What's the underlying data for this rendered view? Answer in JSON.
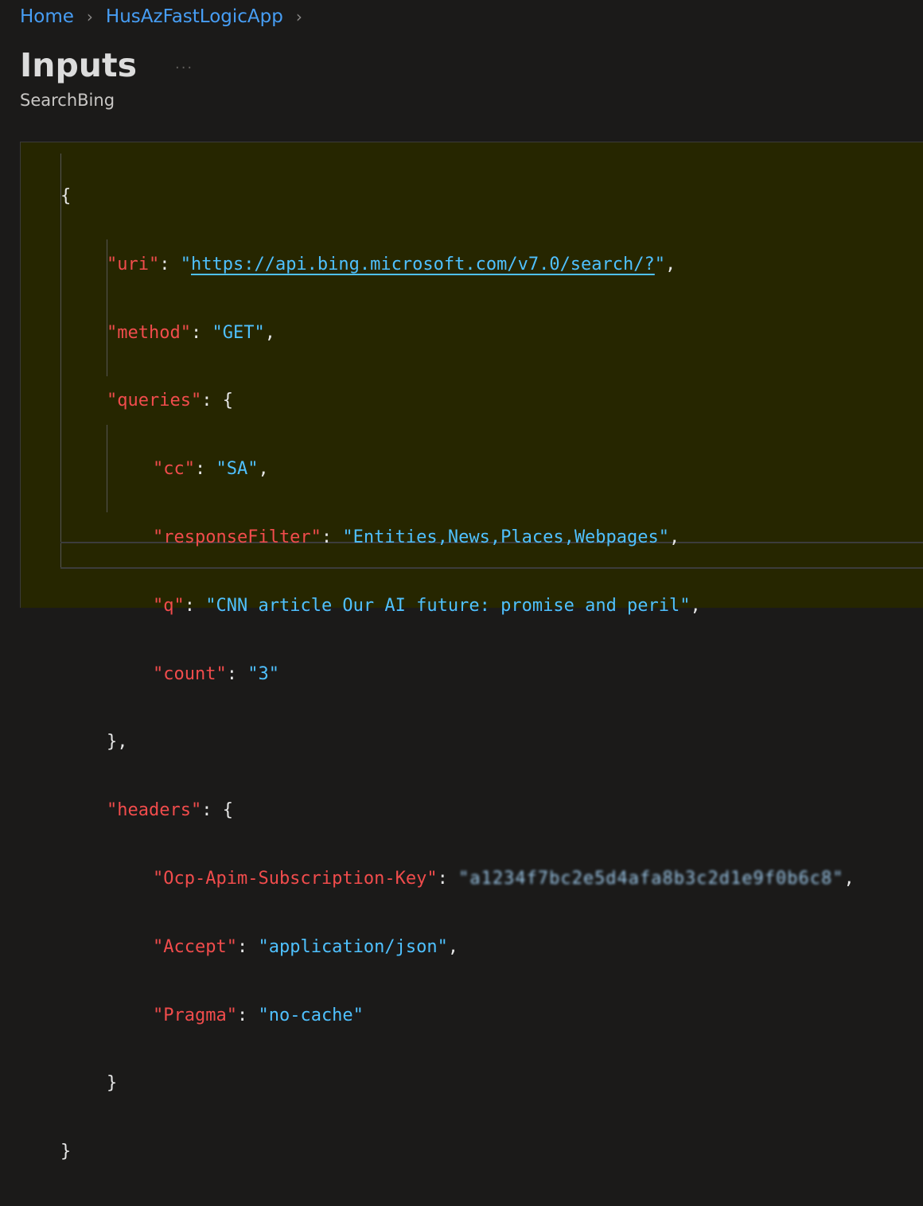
{
  "breadcrumb": {
    "items": [
      "Home",
      "HusAzFastLogicApp"
    ],
    "separator": ">"
  },
  "page": {
    "title": "Inputs",
    "more": "...",
    "subtitle": "SearchBing"
  },
  "code": {
    "open_brace": "{",
    "close_brace": "}",
    "uri_key": "\"uri\"",
    "uri_value": "https://api.bing.microsoft.com/v7.0/search/?",
    "method_key": "\"method\"",
    "method_value": "\"GET\"",
    "queries_key": "\"queries\"",
    "cc_key": "\"cc\"",
    "cc_value": "\"SA\"",
    "responseFilter_key": "\"responseFilter\"",
    "responseFilter_value": "\"Entities,News,Places,Webpages\"",
    "q_key": "\"q\"",
    "q_value": "\"CNN article Our AI future: promise and peril\"",
    "count_key": "\"count\"",
    "count_value": "\"3\"",
    "headers_key": "\"headers\"",
    "subscription_key": "\"Ocp-Apim-Subscription-Key\"",
    "subscription_value_redacted": "\"a1234f7bc2e5d4afa8b3c2d1e9f0b6c8\"",
    "accept_key": "\"Accept\"",
    "accept_value": "\"application/json\"",
    "pragma_key": "\"Pragma\"",
    "pragma_value": "\"no-cache\""
  },
  "colors": {
    "background": "#1b1a19",
    "panel": "#262600",
    "link": "#479ef5",
    "json_key": "#f14c4c",
    "json_string": "#4fc1ff"
  }
}
